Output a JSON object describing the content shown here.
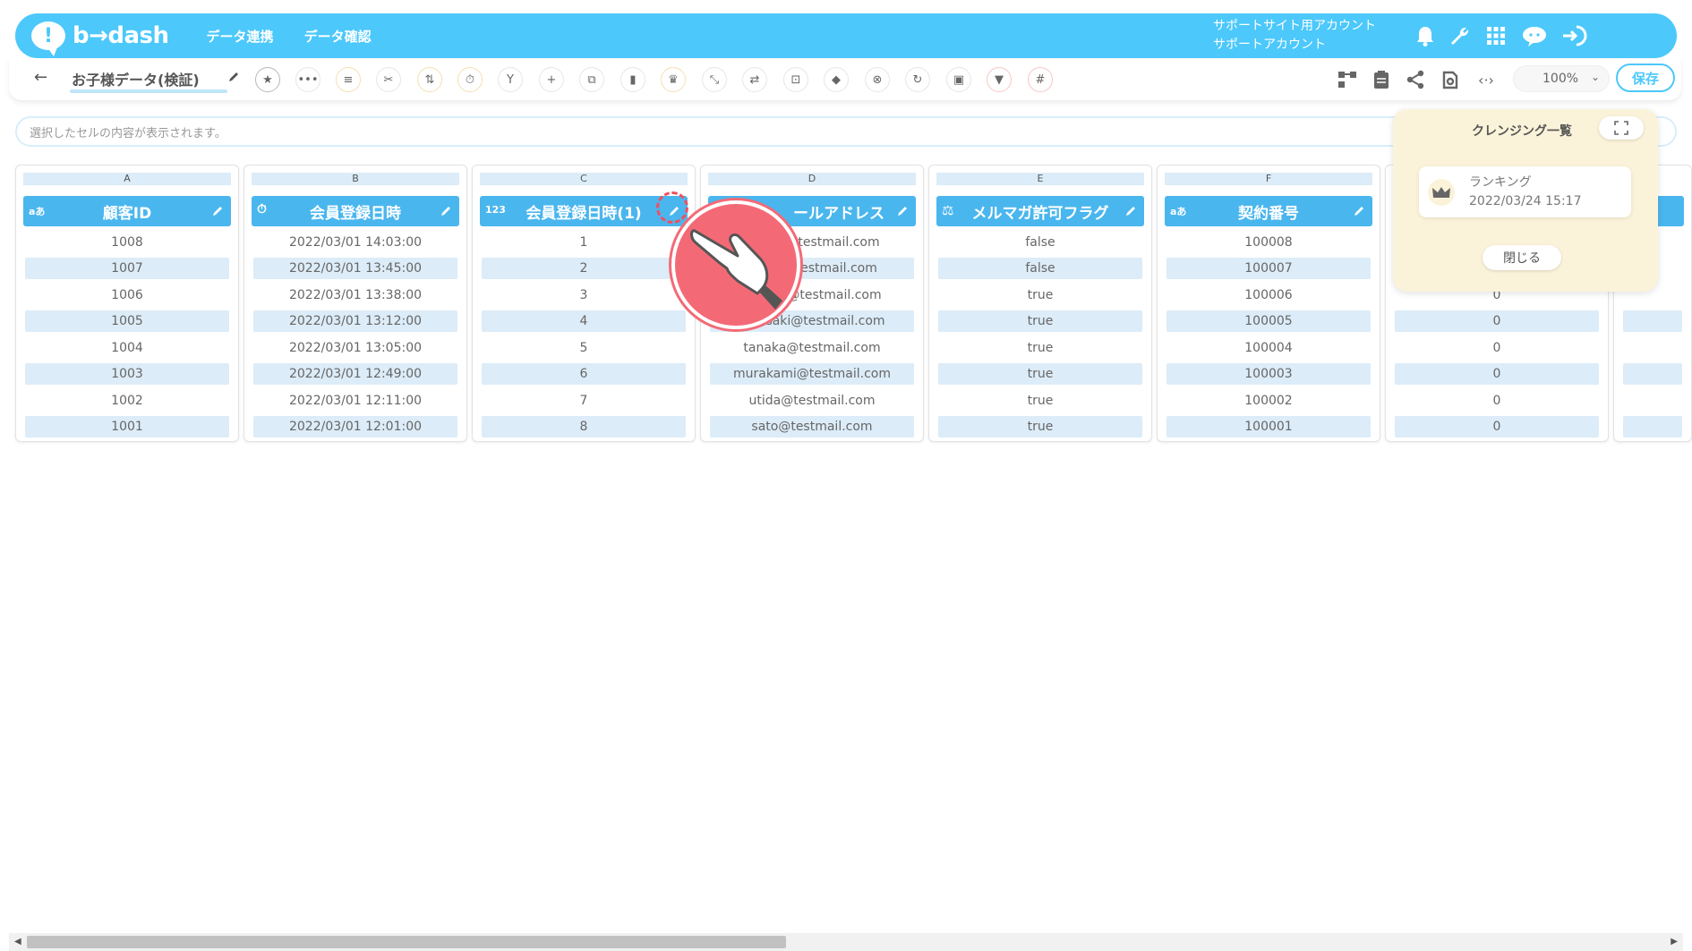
{
  "header": {
    "logo_text": "b→dash",
    "nav": [
      "データ連携",
      "データ確認"
    ],
    "account_line1": "サポートサイト用アカウント",
    "account_line2": "サポートアカウント",
    "icons": [
      "bell-icon",
      "wrench-icon",
      "grid-icon",
      "chat-icon",
      "logout-icon"
    ],
    "color": "#4cc8fb"
  },
  "toolbar": {
    "title": "お子様データ(検証)",
    "zoom": "100%",
    "save_label": "保存"
  },
  "cellbar": {
    "placeholder": "選択したセルの内容が表示されます。"
  },
  "columns": [
    {
      "letter": "A",
      "type_icon": "aあ",
      "header": "顧客ID",
      "cells": [
        "1008",
        "1007",
        "1006",
        "1005",
        "1004",
        "1003",
        "1002",
        "1001"
      ]
    },
    {
      "letter": "B",
      "type_icon": "⏱",
      "header": "会員登録日時",
      "cells": [
        "2022/03/01 14:03:00",
        "2022/03/01 13:45:00",
        "2022/03/01 13:38:00",
        "2022/03/01 13:12:00",
        "2022/03/01 13:05:00",
        "2022/03/01 12:49:00",
        "2022/03/01 12:11:00",
        "2022/03/01 12:01:00"
      ]
    },
    {
      "letter": "C",
      "type_icon": "123",
      "header": "会員登録日時(1)",
      "cells": [
        "1",
        "2",
        "3",
        "4",
        "5",
        "6",
        "7",
        "8"
      ]
    },
    {
      "letter": "D",
      "type_icon": "",
      "header": "ールアドレス",
      "cells": [
        "testmail.com",
        "estmail.com",
        "@testmail.com",
        "saki@testmail.com",
        "tanaka@testmail.com",
        "murakami@testmail.com",
        "utida@testmail.com",
        "sato@testmail.com"
      ]
    },
    {
      "letter": "E",
      "type_icon": "⚖",
      "header": "メルマガ許可フラグ",
      "cells": [
        "false",
        "false",
        "true",
        "true",
        "true",
        "true",
        "true",
        "true"
      ]
    },
    {
      "letter": "F",
      "type_icon": "aあ",
      "header": "契約番号",
      "cells": [
        "100008",
        "100007",
        "100006",
        "100005",
        "100004",
        "100003",
        "100002",
        "100001"
      ]
    },
    {
      "letter": "",
      "type_icon": "",
      "header": "",
      "cells": [
        "",
        "",
        "0",
        "0",
        "0",
        "0",
        "0",
        "0"
      ]
    }
  ],
  "cleansing_panel": {
    "title": "クレンジング一覧",
    "card_name": "ランキング",
    "card_date": "2022/03/24 15:17",
    "close_label": "閉じる"
  }
}
